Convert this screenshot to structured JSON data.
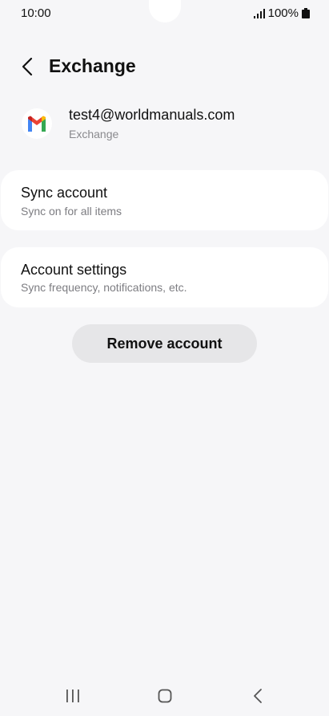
{
  "status_bar": {
    "time": "10:00",
    "battery": "100%"
  },
  "header": {
    "title": "Exchange"
  },
  "account": {
    "email": "test4@worldmanuals.com",
    "type": "Exchange",
    "logo_icon": "gmail-icon"
  },
  "cards": {
    "sync": {
      "title": "Sync account",
      "subtitle": "Sync on for all items"
    },
    "settings": {
      "title": "Account settings",
      "subtitle": "Sync frequency, notifications, etc."
    }
  },
  "remove_button": {
    "label": "Remove account"
  },
  "nav_bar": {
    "recents_icon": "recents-icon",
    "home_icon": "home-icon",
    "back_icon": "back-icon"
  },
  "colors": {
    "background": "#f6f6f8",
    "card": "#ffffff",
    "button": "#e6e6e8",
    "gmail_red": "#ea4335",
    "gmail_blue": "#4285f4",
    "gmail_green": "#34a853",
    "gmail_yellow": "#fbbc04"
  }
}
